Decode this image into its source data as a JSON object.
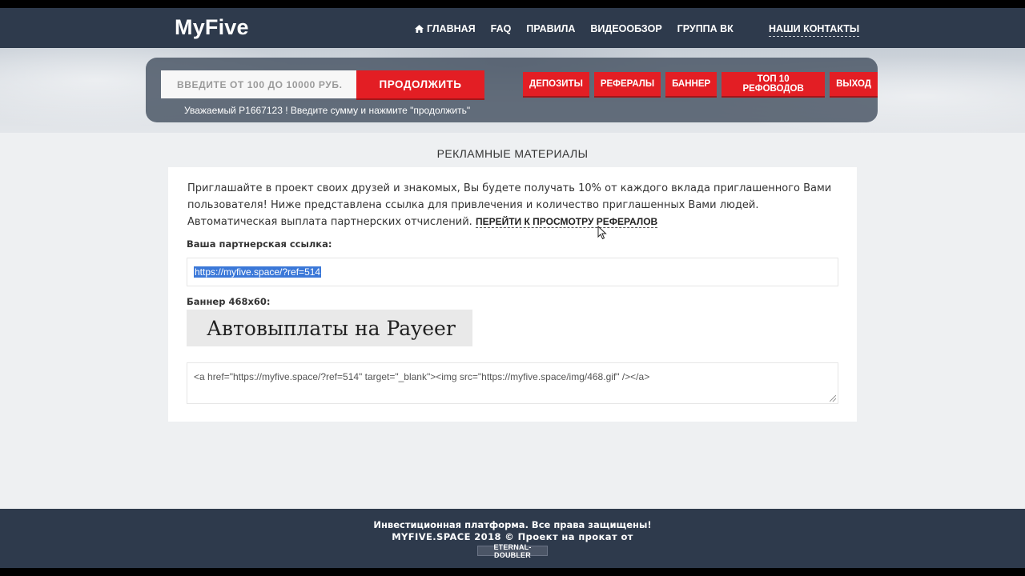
{
  "header": {
    "logo": "MyFive",
    "nav": [
      {
        "label": "ГЛАВНАЯ",
        "icon": "home-icon"
      },
      {
        "label": "FAQ"
      },
      {
        "label": "ПРАВИЛА"
      },
      {
        "label": "ВИДЕООБЗОР"
      },
      {
        "label": "ГРУППА ВК"
      }
    ],
    "contacts": "НАШИ КОНТАКТЫ"
  },
  "deposit_panel": {
    "placeholder": "ВВЕДИТЕ ОТ 100 ДО 10000 РУБ.",
    "continue_label": "ПРОДОЛЖИТЬ",
    "hint": "Уважаемый P1667123 ! Введите сумму и нажмите \"продолжить\"",
    "menu": [
      "ДЕПОЗИТЫ",
      "РЕФЕРАЛЫ",
      "БАННЕР",
      "ТОП 10 РЕФОВОДОВ",
      "ВЫХОД"
    ]
  },
  "content": {
    "title": "РЕКЛАМНЫЕ МАТЕРИАЛЫ",
    "intro": "Приглашайте в проект своих друзей и знакомых, Вы будете получать 10% от каждого вклада приглашенного Вами пользователя! Ниже представлена ссылка для привлечения и количество приглашенных Вами людей. Автоматическая выплата партнерских отчислений.",
    "view_referrals_link": "ПЕРЕЙТИ К ПРОСМОТРУ РЕФЕРАЛОВ",
    "ref_label": "Ваша партнерская ссылка:",
    "ref_url": "https://myfive.space/?ref=514",
    "banner_label": "Баннер 468x60:",
    "banner_text": "Автовыплаты на Payeer",
    "banner_code": "<a href=\"https://myfive.space/?ref=514\" target=\"_blank\"><img src=\"https://myfive.space/img/468.gif\" /></a>"
  },
  "footer": {
    "line1": "Инвестиционная платформа. Все права защищены!",
    "line2": "MYFIVE.SPACE 2018 © Проект на прокат от",
    "badge": "ETERNAL-DOUBLER"
  },
  "colors": {
    "accent_red": "#e31e24",
    "navbar": "#2e3a4c",
    "selection": "#3b78d8"
  }
}
